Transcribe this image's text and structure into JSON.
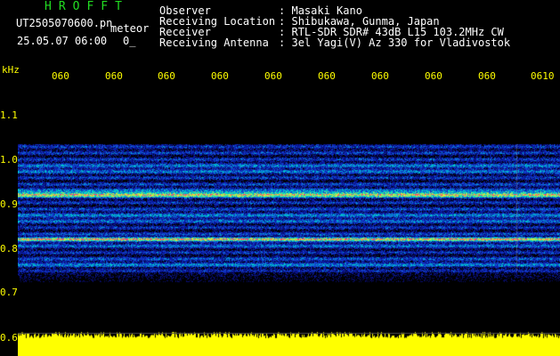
{
  "header": {
    "logo": "HROFFT",
    "filename": "UT2505070600.pn",
    "file_type": "meteor",
    "datetime": "25.05.07 06:00",
    "frame_marker": "0_",
    "meta": [
      {
        "key": "Observer",
        "sep": ":",
        "value": "Masaki Kano"
      },
      {
        "key": "Receiving Location",
        "sep": ":",
        "value": "Shibukawa, Gunma, Japan"
      },
      {
        "key": "Receiver",
        "sep": ":",
        "value": "RTL-SDR SDR# 43dB L15 103.2MHz CW"
      },
      {
        "key": "Receiving Antenna",
        "sep": ":",
        "value": "3el Yagi(V) Az 330 for Vladivostok"
      }
    ]
  },
  "axis": {
    "unit": "kHz",
    "y_ticks": [
      "1.1",
      "1.0",
      "0.9",
      "0.8",
      "0.7",
      "0.6"
    ],
    "time_ticks": [
      "060",
      "060",
      "060",
      "060",
      "060",
      "060",
      "060",
      "060",
      "060",
      "0610"
    ]
  },
  "colors": {
    "background": "#000000",
    "label_text": "#ffff00",
    "header_green": "#22dd22",
    "header_white": "#ffffff",
    "signal_low": "#0a1aa0",
    "signal_mid": "#00d0d0",
    "signal_high": "#ff2a6a",
    "power_bar": "#ffff00",
    "grid": "#4a4a4a"
  }
}
